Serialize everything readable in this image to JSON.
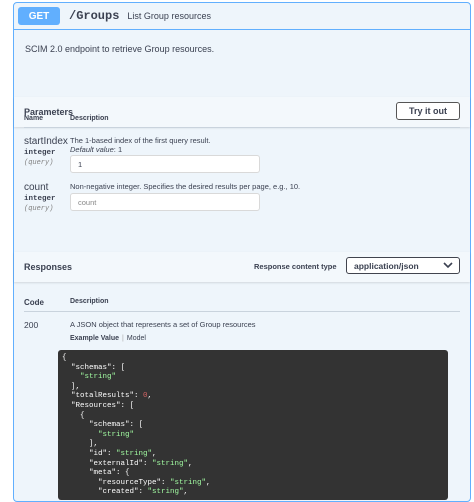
{
  "operation": {
    "method": "GET",
    "path": "/Groups",
    "summary": "List Group resources",
    "description": "SCIM 2.0 endpoint to retrieve Group resources."
  },
  "parameters": {
    "title": "Parameters",
    "try_button": "Try it out",
    "col_name": "Name",
    "col_description": "Description",
    "items": [
      {
        "name": "startIndex",
        "type": "integer",
        "in": "(query)",
        "description": "The 1-based index of the first query result.",
        "default_label": "Default value",
        "default_value": ": 1",
        "value": "1"
      },
      {
        "name": "count",
        "type": "integer",
        "in": "(query)",
        "description": "Non-negative integer. Specifies the desired results per page, e.g., 10.",
        "placeholder": "count"
      }
    ]
  },
  "responses": {
    "title": "Responses",
    "content_type_label": "Response content type",
    "content_type_value": "application/json",
    "col_code": "Code",
    "col_description": "Description",
    "items": [
      {
        "code": "200",
        "description": "A JSON object that represents a set of Group resources",
        "tab_example": "Example Value",
        "tab_model": "Model"
      }
    ]
  },
  "example_code": {
    "l1": "{",
    "l2_key": "  \"schemas\": [",
    "l3_str": "    \"string\"",
    "l4": "  ],",
    "l5_key": "  \"totalResults\": ",
    "l5_num": "0",
    "l5_end": ",",
    "l6": "  \"Resources\": [",
    "l7": "    {",
    "l8": "      \"schemas\": [",
    "l9_str": "        \"string\"",
    "l10": "      ],",
    "l11_key": "      \"id\": ",
    "l11_str": "\"string\"",
    "l11_end": ",",
    "l12_key": "      \"externalId\": ",
    "l12_str": "\"string\"",
    "l12_end": ",",
    "l13": "      \"meta\": {",
    "l14_key": "        \"resourceType\": ",
    "l14_str": "\"string\"",
    "l14_end": ",",
    "l15_key": "        \"created\": ",
    "l15_str": "\"string\"",
    "l15_end": ","
  },
  "colors": {
    "accent": "#61affe",
    "panel_bg": "#eef5fb",
    "code_bg": "#333333"
  }
}
